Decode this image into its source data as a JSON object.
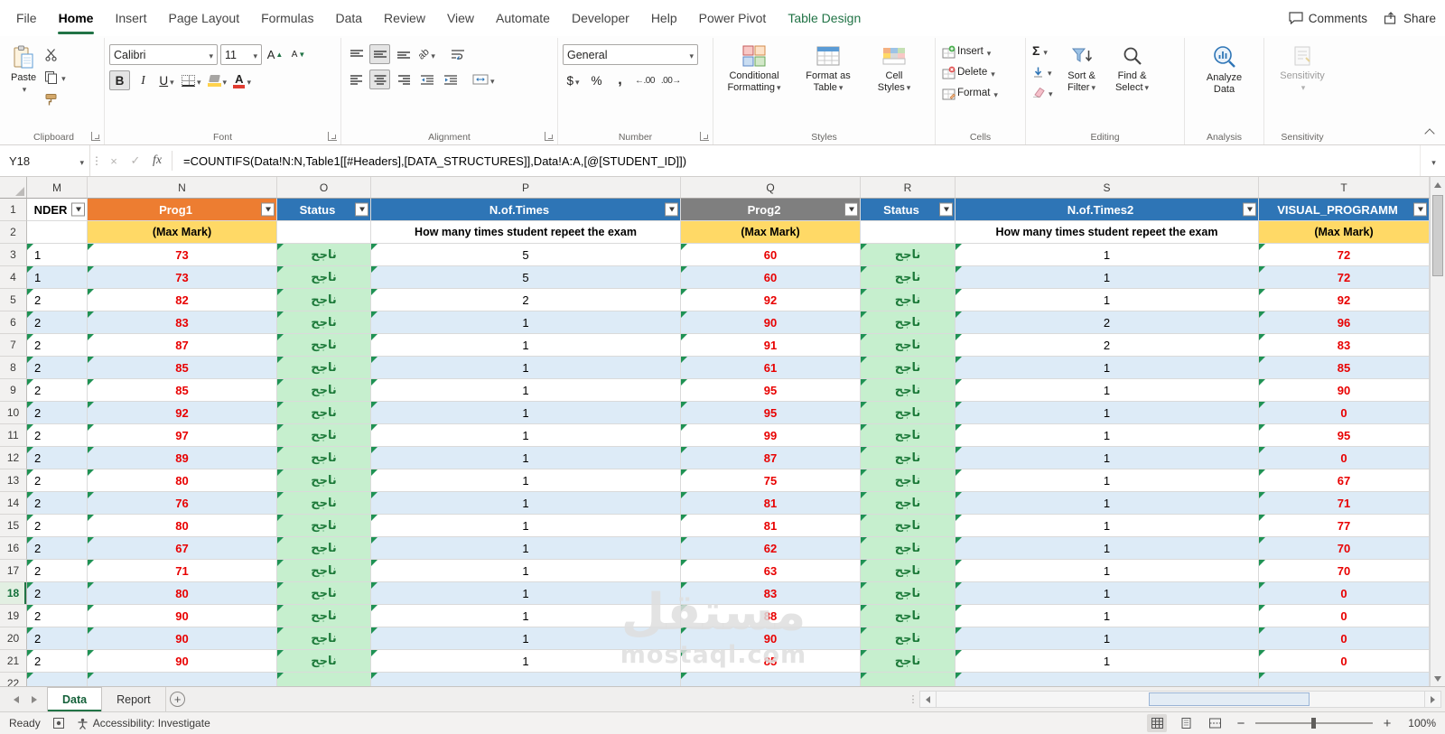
{
  "ribbon_tabs": {
    "items": [
      {
        "label": "File",
        "active": false,
        "contextual": false
      },
      {
        "label": "Home",
        "active": true,
        "contextual": false
      },
      {
        "label": "Insert",
        "active": false,
        "contextual": false
      },
      {
        "label": "Page Layout",
        "active": false,
        "contextual": false
      },
      {
        "label": "Formulas",
        "active": false,
        "contextual": false
      },
      {
        "label": "Data",
        "active": false,
        "contextual": false
      },
      {
        "label": "Review",
        "active": false,
        "contextual": false
      },
      {
        "label": "View",
        "active": false,
        "contextual": false
      },
      {
        "label": "Automate",
        "active": false,
        "contextual": false
      },
      {
        "label": "Developer",
        "active": false,
        "contextual": false
      },
      {
        "label": "Help",
        "active": false,
        "contextual": false
      },
      {
        "label": "Power Pivot",
        "active": false,
        "contextual": false
      },
      {
        "label": "Table Design",
        "active": false,
        "contextual": true
      }
    ],
    "comments_label": "Comments",
    "share_label": "Share"
  },
  "ribbon": {
    "groups": {
      "clipboard": "Clipboard",
      "font": "Font",
      "alignment": "Alignment",
      "number": "Number",
      "styles": "Styles",
      "cells": "Cells",
      "editing": "Editing",
      "analysis": "Analysis",
      "sensitivity": "Sensitivity"
    },
    "paste": "Paste",
    "font_name": "Calibri",
    "font_size": "11",
    "number_format": "General",
    "conditional_formatting": [
      "Conditional",
      "Formatting"
    ],
    "format_as_table": [
      "Format as",
      "Table"
    ],
    "cell_styles": [
      "Cell",
      "Styles"
    ],
    "insert": "Insert",
    "delete": "Delete",
    "format": "Format",
    "sort_filter": [
      "Sort &",
      "Filter"
    ],
    "find_select": [
      "Find &",
      "Select"
    ],
    "analyze_data": [
      "Analyze",
      "Data"
    ],
    "sensitivity_button": "Sensitivity"
  },
  "icons": {
    "bold": "B",
    "italic": "I",
    "underline": "U",
    "font_letter": "A",
    "orientation": "ab",
    "dollar": "$",
    "percent": "%",
    "comma": ",",
    "increase_decimal": "←.00",
    "decrease_decimal": ".00→",
    "sigma": "Σ",
    "cancel": "×",
    "enter": "✓",
    "dots": "⋮",
    "plus": "+",
    "minus": "−"
  },
  "formula_bar": {
    "name_box": "Y18",
    "fx": "fx",
    "formula": "=COUNTIFS(Data!N:N,Table1[[#Headers],[DATA_STRUCTURES]],Data!A:A,[@[STUDENT_ID]])"
  },
  "grid": {
    "columns": [
      "M",
      "N",
      "O",
      "P",
      "Q",
      "R",
      "S",
      "T"
    ],
    "selected_row": 18,
    "header_row": [
      {
        "label": "NDER",
        "bg": "#FFFFFF",
        "color": "#000000"
      },
      {
        "label": "Prog1",
        "bg": "#ED7D31",
        "color": "#FFFFFF"
      },
      {
        "label": "Status",
        "bg": "#2E75B6",
        "color": "#FFFFFF"
      },
      {
        "label": "N.of.Times",
        "bg": "#2E75B6",
        "color": "#FFFFFF"
      },
      {
        "label": "Prog2",
        "bg": "#7F7F7F",
        "color": "#FFFFFF"
      },
      {
        "label": "Status",
        "bg": "#2E75B6",
        "color": "#FFFFFF"
      },
      {
        "label": "N.of.Times2",
        "bg": "#2E75B6",
        "color": "#FFFFFF"
      },
      {
        "label": "VISUAL_PROGRAMM",
        "bg": "#2E75B6",
        "color": "#FFFFFF"
      }
    ],
    "subheader_row": [
      {
        "label": "",
        "bg": "#FFFFFF"
      },
      {
        "label": "(Max Mark)",
        "bg": "#FFD966"
      },
      {
        "label": "",
        "bg": "#FFFFFF"
      },
      {
        "label": "How many times student repeet the exam",
        "bg": "#FFFFFF"
      },
      {
        "label": "(Max Mark)",
        "bg": "#FFD966"
      },
      {
        "label": "",
        "bg": "#FFFFFF"
      },
      {
        "label": "How many times student repeet the exam",
        "bg": "#FFFFFF"
      },
      {
        "label": "(Max Mark)",
        "bg": "#FFD966"
      }
    ],
    "rows": [
      {
        "num": 3,
        "m": "1",
        "n": "73",
        "o": "ناجح",
        "p": "5",
        "q": "60",
        "r": "ناجح",
        "s": "1",
        "t": "72"
      },
      {
        "num": 4,
        "m": "1",
        "n": "73",
        "o": "ناجح",
        "p": "5",
        "q": "60",
        "r": "ناجح",
        "s": "1",
        "t": "72"
      },
      {
        "num": 5,
        "m": "2",
        "n": "82",
        "o": "ناجح",
        "p": "2",
        "q": "92",
        "r": "ناجح",
        "s": "1",
        "t": "92"
      },
      {
        "num": 6,
        "m": "2",
        "n": "83",
        "o": "ناجح",
        "p": "1",
        "q": "90",
        "r": "ناجح",
        "s": "2",
        "t": "96"
      },
      {
        "num": 7,
        "m": "2",
        "n": "87",
        "o": "ناجح",
        "p": "1",
        "q": "91",
        "r": "ناجح",
        "s": "2",
        "t": "83"
      },
      {
        "num": 8,
        "m": "2",
        "n": "85",
        "o": "ناجح",
        "p": "1",
        "q": "61",
        "r": "ناجح",
        "s": "1",
        "t": "85"
      },
      {
        "num": 9,
        "m": "2",
        "n": "85",
        "o": "ناجح",
        "p": "1",
        "q": "95",
        "r": "ناجح",
        "s": "1",
        "t": "90"
      },
      {
        "num": 10,
        "m": "2",
        "n": "92",
        "o": "ناجح",
        "p": "1",
        "q": "95",
        "r": "ناجح",
        "s": "1",
        "t": "0"
      },
      {
        "num": 11,
        "m": "2",
        "n": "97",
        "o": "ناجح",
        "p": "1",
        "q": "99",
        "r": "ناجح",
        "s": "1",
        "t": "95"
      },
      {
        "num": 12,
        "m": "2",
        "n": "89",
        "o": "ناجح",
        "p": "1",
        "q": "87",
        "r": "ناجح",
        "s": "1",
        "t": "0"
      },
      {
        "num": 13,
        "m": "2",
        "n": "80",
        "o": "ناجح",
        "p": "1",
        "q": "75",
        "r": "ناجح",
        "s": "1",
        "t": "67"
      },
      {
        "num": 14,
        "m": "2",
        "n": "76",
        "o": "ناجح",
        "p": "1",
        "q": "81",
        "r": "ناجح",
        "s": "1",
        "t": "71"
      },
      {
        "num": 15,
        "m": "2",
        "n": "80",
        "o": "ناجح",
        "p": "1",
        "q": "81",
        "r": "ناجح",
        "s": "1",
        "t": "77"
      },
      {
        "num": 16,
        "m": "2",
        "n": "67",
        "o": "ناجح",
        "p": "1",
        "q": "62",
        "r": "ناجح",
        "s": "1",
        "t": "70"
      },
      {
        "num": 17,
        "m": "2",
        "n": "71",
        "o": "ناجح",
        "p": "1",
        "q": "63",
        "r": "ناجح",
        "s": "1",
        "t": "70"
      },
      {
        "num": 18,
        "m": "2",
        "n": "80",
        "o": "ناجح",
        "p": "1",
        "q": "83",
        "r": "ناجح",
        "s": "1",
        "t": "0"
      },
      {
        "num": 19,
        "m": "2",
        "n": "90",
        "o": "ناجح",
        "p": "1",
        "q": "88",
        "r": "ناجح",
        "s": "1",
        "t": "0"
      },
      {
        "num": 20,
        "m": "2",
        "n": "90",
        "o": "ناجح",
        "p": "1",
        "q": "90",
        "r": "ناجح",
        "s": "1",
        "t": "0"
      },
      {
        "num": 21,
        "m": "2",
        "n": "90",
        "o": "ناجح",
        "p": "1",
        "q": "85",
        "r": "ناجح",
        "s": "1",
        "t": "0"
      },
      {
        "num": 22,
        "m": "",
        "n": "",
        "o": "",
        "p": "",
        "q": "",
        "r": "",
        "s": "",
        "t": ""
      }
    ]
  },
  "sheet_tabs": {
    "tabs": [
      {
        "label": "Data",
        "active": true
      },
      {
        "label": "Report",
        "active": false
      }
    ]
  },
  "status_bar": {
    "ready": "Ready",
    "accessibility": "Accessibility: Investigate",
    "zoom": "100%"
  },
  "watermark": {
    "arabic": "مستقل",
    "latin": "mostaql.com"
  }
}
